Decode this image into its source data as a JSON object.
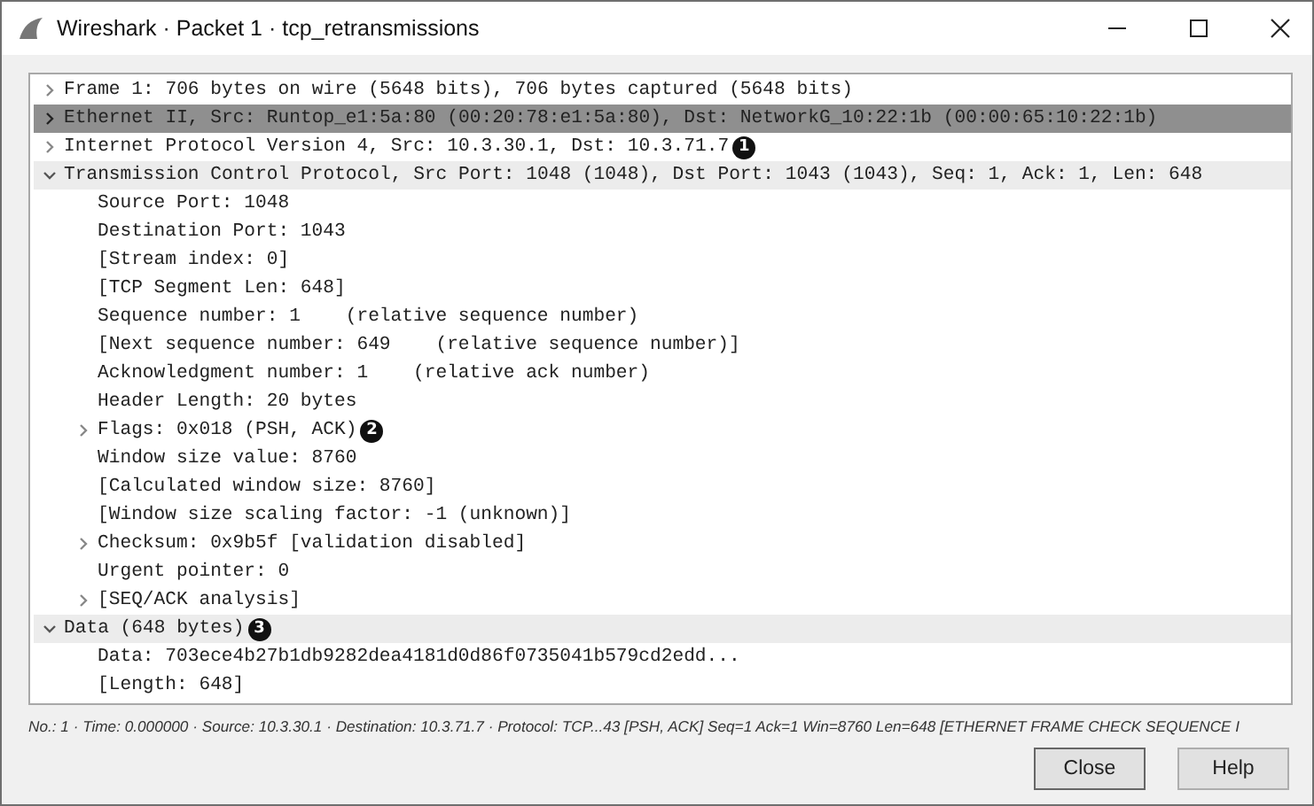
{
  "window": {
    "title": "Wireshark · Packet 1 · tcp_retransmissions"
  },
  "tree": [
    {
      "label": "Frame 1: 706 bytes on wire (5648 bits), 706 bytes captured (5648 bits)",
      "expandable": true,
      "expanded": false,
      "selected": false
    },
    {
      "label": "Ethernet II, Src: Runtop_e1:5a:80 (00:20:78:e1:5a:80), Dst: NetworkG_10:22:1b (00:00:65:10:22:1b)",
      "expandable": true,
      "expanded": false,
      "selected": true
    },
    {
      "label": "Internet Protocol Version 4, Src: 10.3.30.1, Dst: 10.3.71.7",
      "expandable": true,
      "expanded": false,
      "selected": false,
      "callout": "1"
    },
    {
      "label": "Transmission Control Protocol, Src Port: 1048 (1048), Dst Port: 1043 (1043), Seq: 1, Ack: 1, Len: 648",
      "expandable": true,
      "expanded": true,
      "selected": false,
      "children": [
        {
          "label": "Source Port: 1048",
          "expandable": false,
          "expanded": false,
          "selected": false
        },
        {
          "label": "Destination Port: 1043",
          "expandable": false,
          "expanded": false,
          "selected": false
        },
        {
          "label": "[Stream index: 0]",
          "expandable": false,
          "expanded": false,
          "selected": false
        },
        {
          "label": "[TCP Segment Len: 648]",
          "expandable": false,
          "expanded": false,
          "selected": false
        },
        {
          "label": "Sequence number: 1    (relative sequence number)",
          "expandable": false,
          "expanded": false,
          "selected": false
        },
        {
          "label": "[Next sequence number: 649    (relative sequence number)]",
          "expandable": false,
          "expanded": false,
          "selected": false
        },
        {
          "label": "Acknowledgment number: 1    (relative ack number)",
          "expandable": false,
          "expanded": false,
          "selected": false
        },
        {
          "label": "Header Length: 20 bytes",
          "expandable": false,
          "expanded": false,
          "selected": false
        },
        {
          "label": "Flags: 0x018 (PSH, ACK)",
          "expandable": true,
          "expanded": false,
          "selected": false,
          "callout": "2"
        },
        {
          "label": "Window size value: 8760",
          "expandable": false,
          "expanded": false,
          "selected": false
        },
        {
          "label": "[Calculated window size: 8760]",
          "expandable": false,
          "expanded": false,
          "selected": false
        },
        {
          "label": "[Window size scaling factor: -1 (unknown)]",
          "expandable": false,
          "expanded": false,
          "selected": false
        },
        {
          "label": "Checksum: 0x9b5f [validation disabled]",
          "expandable": true,
          "expanded": false,
          "selected": false
        },
        {
          "label": "Urgent pointer: 0",
          "expandable": false,
          "expanded": false,
          "selected": false
        },
        {
          "label": "[SEQ/ACK analysis]",
          "expandable": true,
          "expanded": false,
          "selected": false
        }
      ]
    },
    {
      "label": "Data (648 bytes)",
      "expandable": true,
      "expanded": true,
      "selected": false,
      "callout": "3",
      "children": [
        {
          "label": "Data: 703ece4b27b1db9282dea4181d0d86f0735041b579cd2edd...",
          "expandable": false,
          "expanded": false,
          "selected": false
        },
        {
          "label": "[Length: 648]",
          "expandable": false,
          "expanded": false,
          "selected": false
        }
      ]
    }
  ],
  "status_line": "No.: 1 · Time: 0.000000 · Source: 10.3.30.1 · Destination: 10.3.71.7 · Protocol: TCP...43 [PSH, ACK] Seq=1 Ack=1 Win=8760 Len=648 [ETHERNET FRAME CHECK SEQUENCE I",
  "buttons": [
    "Close",
    "Help"
  ]
}
